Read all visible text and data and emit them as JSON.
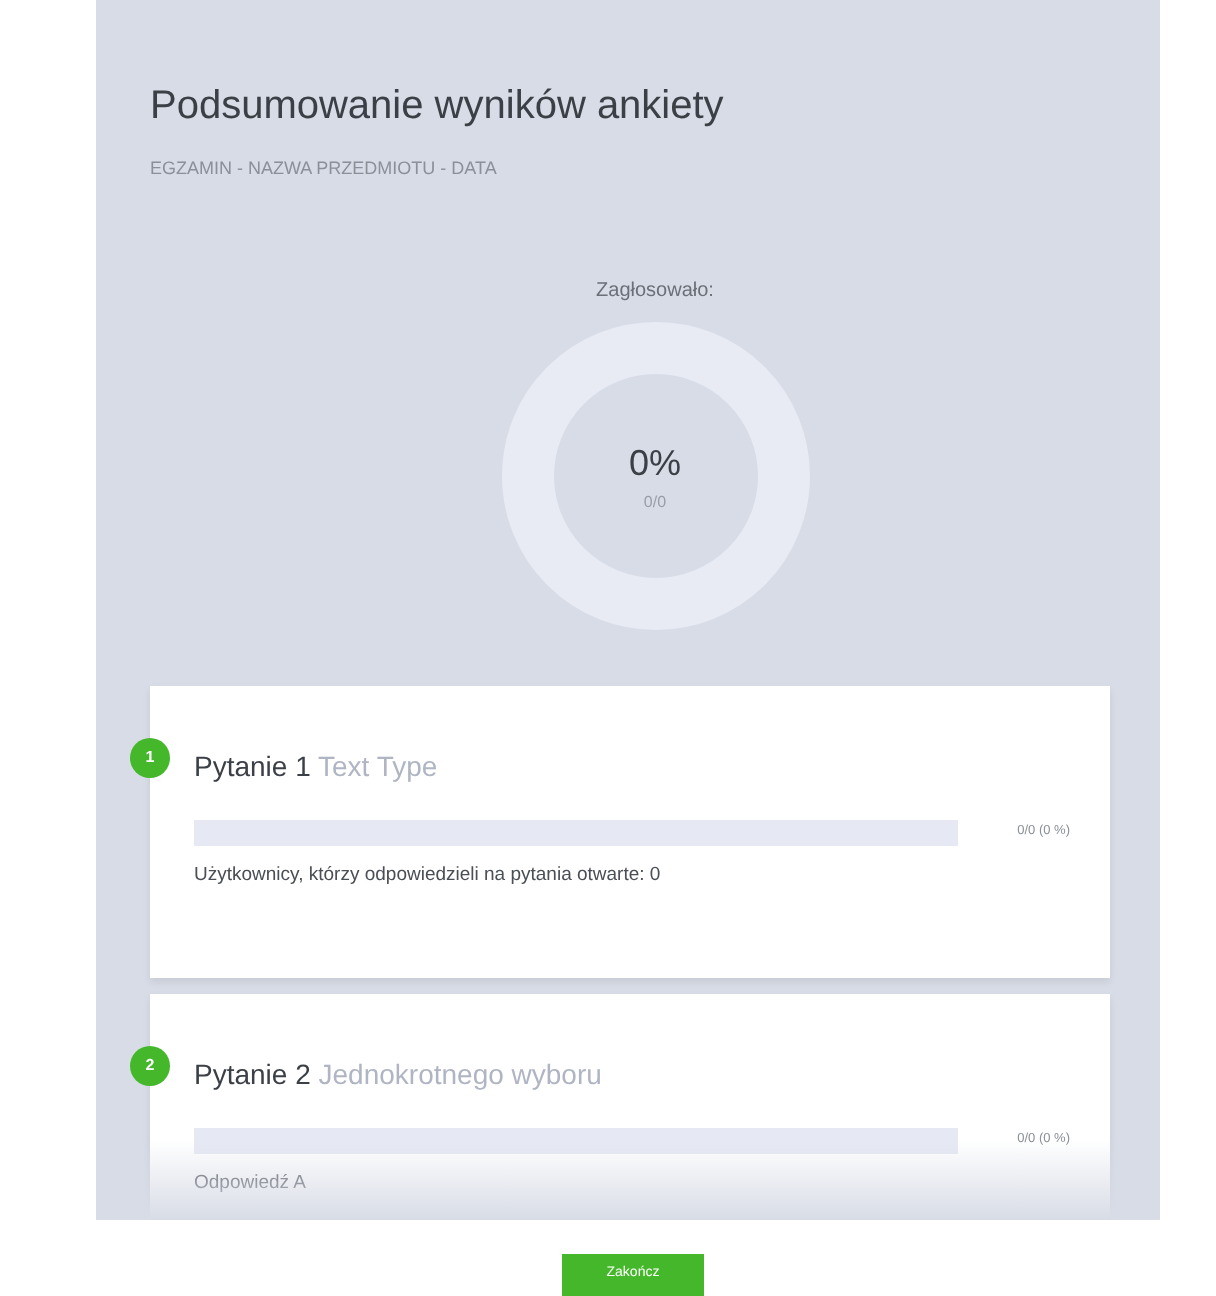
{
  "header": {
    "title": "Podsumowanie wyników ankiety",
    "subtitle": "EGZAMIN - NAZWA PRZEDMIOTU - DATA"
  },
  "turnout": {
    "label": "Zagłosowało:",
    "percent": "0%",
    "count": "0/0"
  },
  "questions": [
    {
      "number": "1",
      "title": "Pytanie 1",
      "type": "Text Type",
      "answers": [
        {
          "level": 0,
          "reading": "0/0 (0 %)"
        }
      ],
      "note": "Użytkownicy, którzy odpowiedzieli na pytania otwarte: 0"
    },
    {
      "number": "2",
      "title": "Pytanie 2",
      "type": "Jednokrotnego wyboru",
      "answers": [
        {
          "level": 0,
          "reading": "0/0 (0 %)",
          "label": "Odpowiedź A"
        }
      ]
    }
  ],
  "finish_button": "Zakończ"
}
